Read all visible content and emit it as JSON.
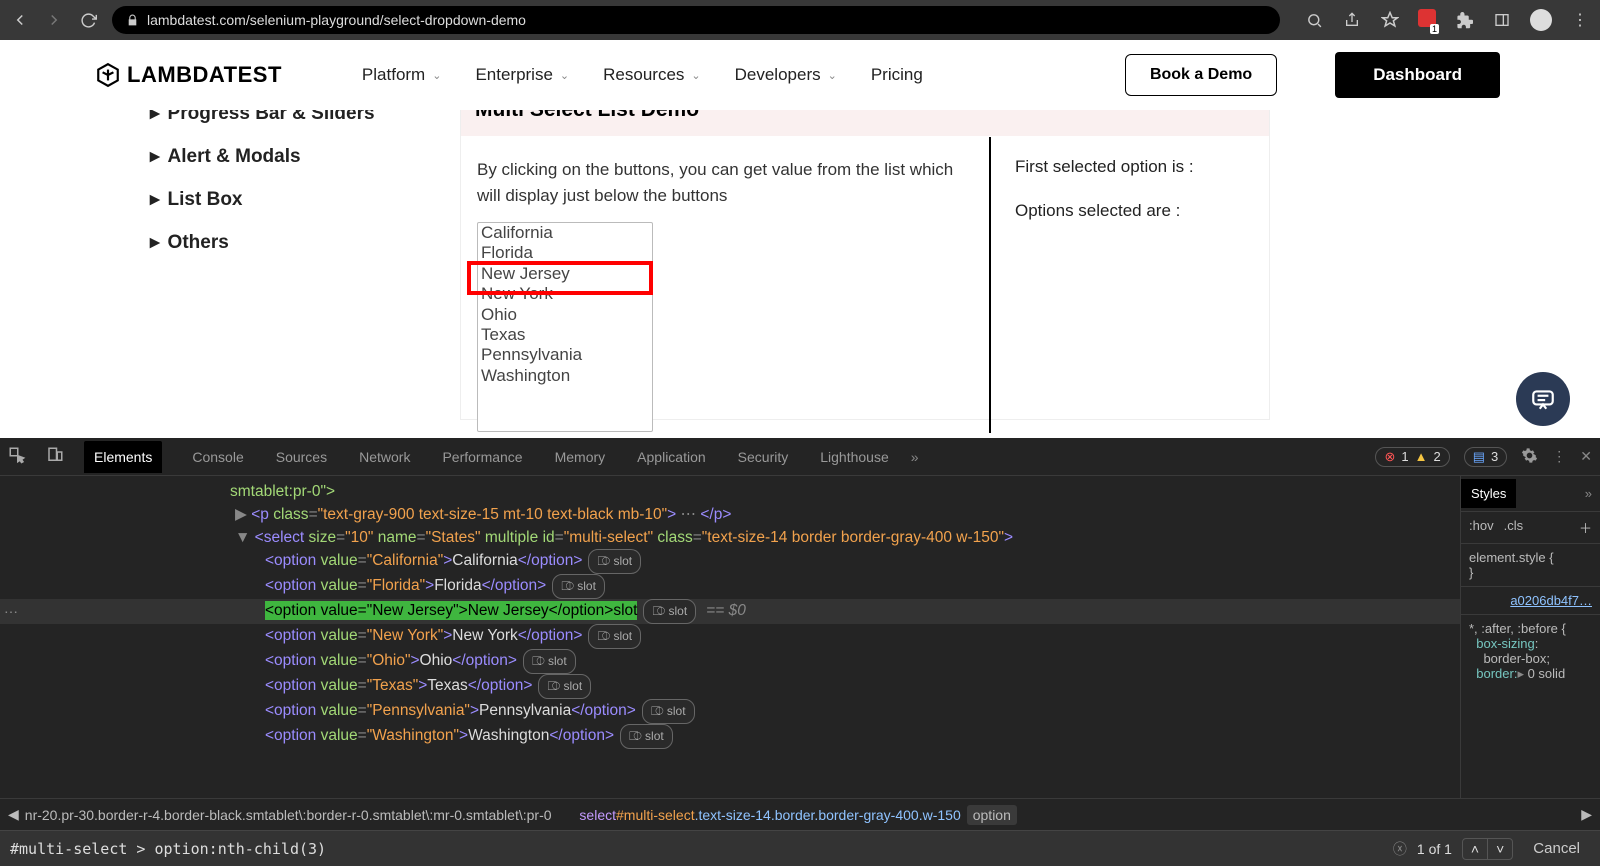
{
  "browser": {
    "url": "lambdatest.com/selenium-playground/select-dropdown-demo",
    "ext_count": "1",
    "errors": "1",
    "warnings": "2",
    "messages": "3"
  },
  "header": {
    "brand": "LAMBDATEST",
    "nav": [
      "Platform",
      "Enterprise",
      "Resources",
      "Developers",
      "Pricing"
    ],
    "cta1": "Book a Demo",
    "cta2": "Dashboard"
  },
  "sidebar": {
    "items": [
      "Progress Bar & Sliders",
      "Alert & Modals",
      "List Box",
      "Others"
    ]
  },
  "demo": {
    "title": "Multi Select List Demo",
    "desc": "By clicking on the buttons, you can get value from the list which will display just below the buttons",
    "options": [
      "California",
      "Florida",
      "New Jersey",
      "New York",
      "Ohio",
      "Texas",
      "Pennsylvania",
      "Washington"
    ],
    "highlight_index": 2,
    "r1": "First selected option is :",
    "r2": "Options selected are :"
  },
  "devtools": {
    "tabs": [
      "Elements",
      "Console",
      "Sources",
      "Network",
      "Performance",
      "Memory",
      "Application",
      "Security",
      "Lighthouse"
    ],
    "active_tab": 0,
    "styles_tab": "Styles",
    "hov": ":hov",
    "cls": ".cls",
    "elstyle": "element.style {",
    "brace": "}",
    "stylefile": "a0206db4f7…",
    "sel2": "*, :after, :before {",
    "p1": "box-sizing",
    "p2": "border-box;",
    "p3": "border:",
    "p4": "0 solid",
    "breadcrumb_left": "nr-20.pr-30.border-r-4.border-black.smtablet\\:border-r-0.smtablet\\:mr-0.smtablet\\:pr-0",
    "bc_select": "select",
    "bc_id": "#multi-select",
    "bc_classes": ".text-size-14.border.border-gray-400.w-150",
    "bc_last": "option",
    "find_value": "#multi-select > option:nth-child(3)",
    "find_count": "1 of 1",
    "cancel": "Cancel",
    "line_top": "smtablet:pr-0\">",
    "p_line": "<p class=\"text-gray-900 text-size-15 mt-10 text-black mb-10\">…</p>",
    "sel_line_open": "<select size=\"10\" name=\"States\" multiple id=\"multi-select\" class=\"text-size-14 border border-gray-400 w-150\">",
    "eq0": "== $0"
  }
}
